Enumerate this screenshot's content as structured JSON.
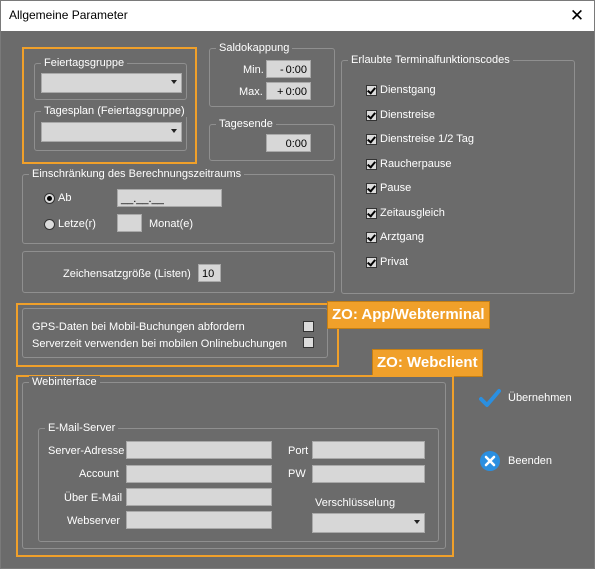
{
  "window": {
    "title": "Allgemeine Parameter",
    "close_glyph": "✕"
  },
  "feiertag": {
    "group_label": "Feiertagsgruppe",
    "tagesplan_label": "Tagesplan (Feiertagsgruppe)"
  },
  "saldo": {
    "group_label": "Saldokappung",
    "min_label": "Min.",
    "min_sign": "-",
    "min_value": "0:00",
    "max_label": "Max.",
    "max_sign": "+",
    "max_value": "0:00"
  },
  "tagesende": {
    "group_label": "Tagesende",
    "value": "0:00"
  },
  "einschraenkung": {
    "group_label": "Einschränkung des Berechnungszeitraums",
    "ab_label": "Ab",
    "ab_value": "__.__.__",
    "letzte_label": "Letze(r)",
    "monat_label": "Monat(e)"
  },
  "zeichensatz": {
    "label": "Zeichensatzgröße (Listen)",
    "value": "10"
  },
  "terminal": {
    "group_label": "Erlaubte Terminalfunktionscodes",
    "items": [
      {
        "label": "Dienstgang",
        "checked": true
      },
      {
        "label": "Dienstreise",
        "checked": true
      },
      {
        "label": "Dienstreise 1/2 Tag",
        "checked": true
      },
      {
        "label": "Raucherpause",
        "checked": true
      },
      {
        "label": "Pause",
        "checked": true
      },
      {
        "label": "Zeitausgleich",
        "checked": true
      },
      {
        "label": "Arztgang",
        "checked": true
      },
      {
        "label": "Privat",
        "checked": true
      }
    ]
  },
  "gps": {
    "gps_label": "GPS-Daten bei Mobil-Buchungen abfordern",
    "server_label": "Serverzeit verwenden bei mobilen Onlinebuchungen"
  },
  "tags": {
    "app": "ZO: App/Webterminal",
    "web": "ZO: Webclient"
  },
  "webinterface": {
    "group_label": "Webinterface",
    "email_group_label": "E-Mail-Server",
    "server_label": "Server-Adresse",
    "account_label": "Account",
    "ueber_label": "Über E-Mail",
    "webserver_label": "Webserver",
    "port_label": "Port",
    "pw_label": "PW",
    "verschl_label": "Verschlüsselung"
  },
  "actions": {
    "uebernehmen": "Übernehmen",
    "beenden": "Beenden"
  },
  "colors": {
    "accent": "#f0a02a",
    "background": "#6b6b6b",
    "check_blue": "#2b8fe0"
  }
}
